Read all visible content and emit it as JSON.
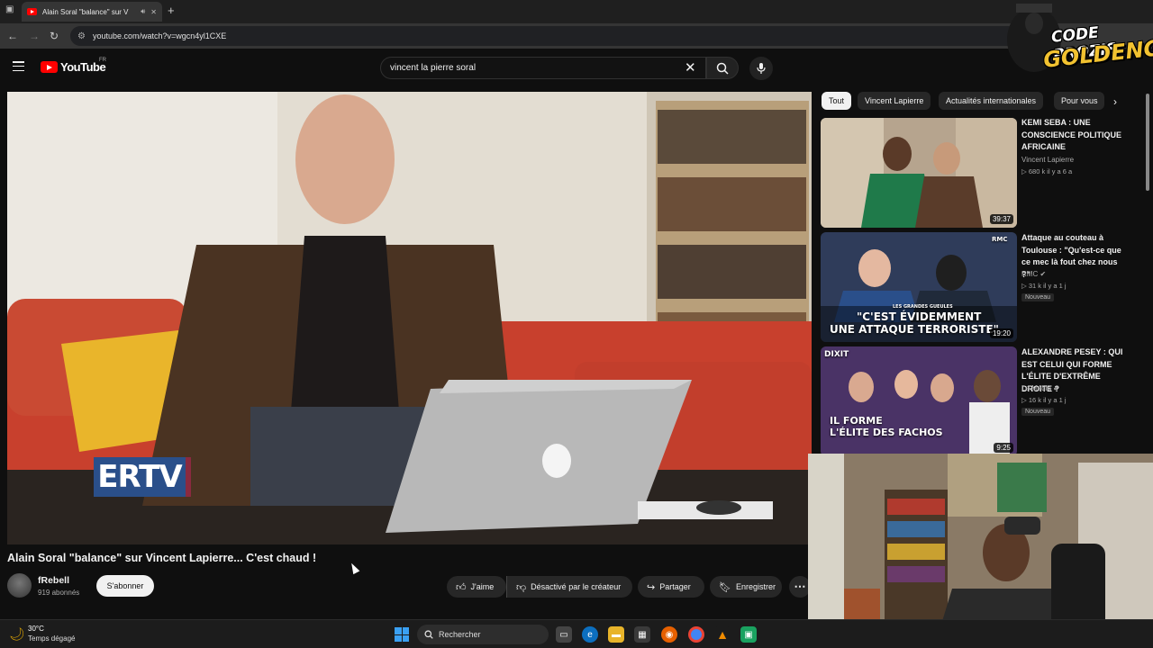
{
  "browser": {
    "tab_title": "Alain Soral \"balance\" sur V",
    "url": "youtube.com/watch?v=wgcn4yl1CXE"
  },
  "youtube": {
    "logo_text": "YouTube",
    "country_code": "FR",
    "search_value": "vincent la pierre soral"
  },
  "video": {
    "title": "Alain Soral \"balance\" sur Vincent Lapierre... C'est chaud !",
    "overlay_logo": "ERTV",
    "channel_name": "fRebell",
    "subscriber_count": "919 abonnés",
    "subscribe_label": "S'abonner",
    "like_label": "J'aime",
    "dislike_label": "Désactivé par le créateur",
    "share_label": "Partager",
    "save_label": "Enregistrer"
  },
  "chips": [
    "Tout",
    "Vincent Lapierre",
    "Actualités internationales",
    "Pour vous"
  ],
  "related": [
    {
      "title": "KEMI SEBA : UNE CONSCIENCE POLITIQUE AFRICAINE",
      "channel": "Vincent Lapierre",
      "meta": "▷ 680 k  il y a 6 a",
      "duration": "39:37",
      "badge": "",
      "verified": false
    },
    {
      "title": "Attaque au couteau à Toulouse : \"Qu'est-ce que ce mec là fout chez nous ?\"",
      "channel": "RMC",
      "meta": "▷ 31 k  il y a 1 j",
      "duration": "19:20",
      "badge": "Nouveau",
      "verified": true,
      "thumb_text_1": "LES GRANDES GUEULES",
      "thumb_text_2": "\"C'EST ÉVIDEMMENT",
      "thumb_text_3": "UNE ATTAQUE TERRORISTE\"",
      "thumb_corner": "RMC"
    },
    {
      "title": "ALEXANDRE PESEY : QUI EST CELUI QUI FORME L'ÉLITE D'EXTRÊME DROITE ?",
      "channel": "Le Média",
      "meta": "▷ 16 k  il y a 1 j",
      "duration": "9:25",
      "badge": "Nouveau",
      "verified": true,
      "thumb_text_1": "DIXIT",
      "thumb_text_2": "IL FORME",
      "thumb_text_3": "L'ÉLITE DES FACHOS"
    }
  ],
  "stream_overlay": {
    "line1": "CODE PROZIS",
    "line2": "GOLDENG"
  },
  "taskbar": {
    "temperature": "30°C",
    "weather": "Temps dégagé",
    "search_placeholder": "Rechercher"
  },
  "colors": {
    "background": "#0f0f0f",
    "yt_red": "#ff0000",
    "chip_active": "#f1f1f1",
    "overlay_gold": "#f2c230"
  }
}
